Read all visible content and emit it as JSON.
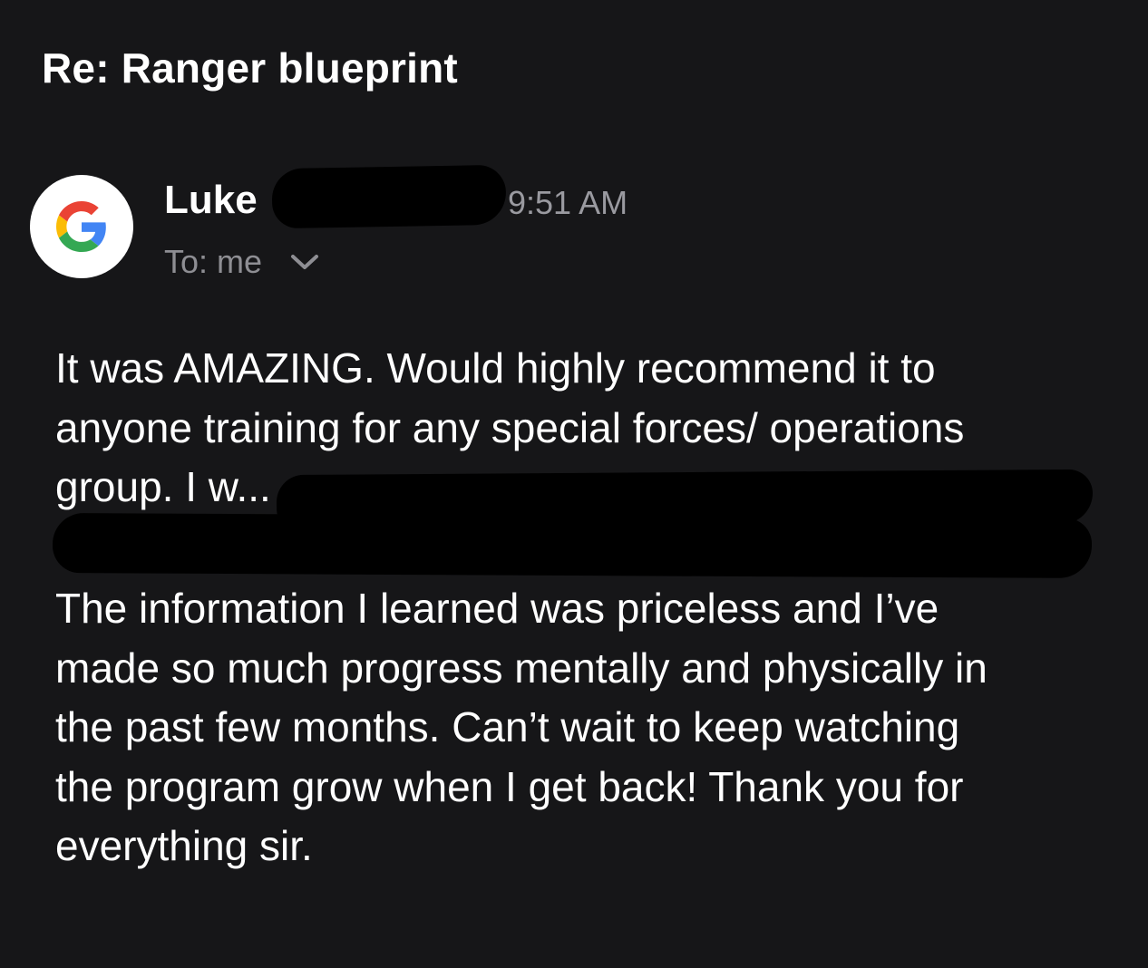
{
  "email": {
    "subject": "Re: Ranger blueprint",
    "sender_name": "Luke",
    "time": "9:51 AM",
    "to_line": "To: me",
    "avatar_icon": "google-g-icon",
    "body_paragraph_1": [
      "It was AMAZING. Would highly recommend it to",
      "anyone training for any special forces/ operations",
      "group. I w..."
    ],
    "body_paragraph_2": [
      "The information I learned was priceless and I’ve",
      "made so much progress mentally and physically in",
      "the past few months. Can’t wait to keep watching",
      "the program grow when I get back! Thank you for",
      "everything sir."
    ]
  },
  "colors": {
    "background": "#161618",
    "text_primary": "#ffffff",
    "text_secondary": "#8e8e93",
    "redaction": "#000000",
    "google_blue": "#4285F4",
    "google_red": "#EA4335",
    "google_yellow": "#FBBC05",
    "google_green": "#34A853"
  }
}
